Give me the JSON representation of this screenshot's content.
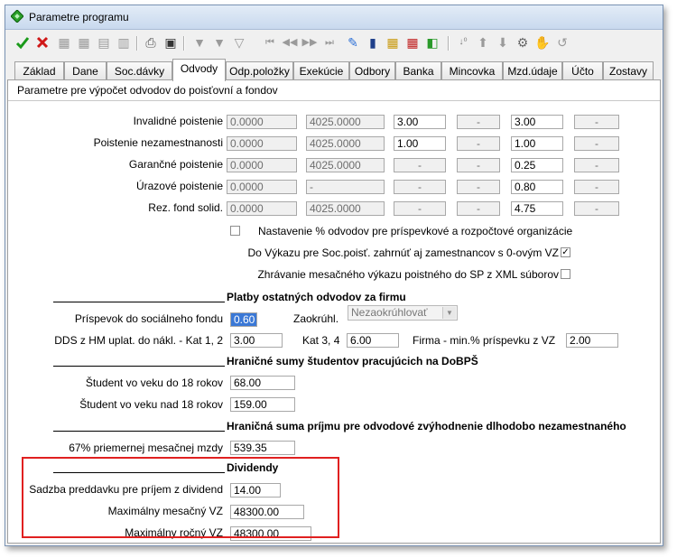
{
  "window": {
    "title": "Parametre programu"
  },
  "tabs": [
    "Základ",
    "Dane",
    "Soc.dávky",
    "Odvody",
    "Odp.položky",
    "Exekúcie",
    "Odbory",
    "Banka",
    "Mincovka",
    "Mzd.údaje",
    "Účto",
    "Zostavy"
  ],
  "active_tab": "Odvody",
  "section_title": "Parametre pre výpočet odvodov do poisťovní a fondov",
  "rows": [
    {
      "label": "Invalidné poistenie",
      "a": "0.0000",
      "b": "4025.0000",
      "c": "3.00",
      "d": "-",
      "e": "3.00",
      "f": "-"
    },
    {
      "label": "Poistenie  nezamestnanosti",
      "a": "0.0000",
      "b": "4025.0000",
      "c": "1.00",
      "d": "-",
      "e": "1.00",
      "f": "-"
    },
    {
      "label": "Garančné poistenie",
      "a": "0.0000",
      "b": "4025.0000",
      "c": "-",
      "d": "-",
      "e": "0.25",
      "f": "-"
    },
    {
      "label": "Úrazové poistenie",
      "a": "0.0000",
      "b": "-",
      "c": "-",
      "d": "-",
      "e": "0.80",
      "f": "-"
    },
    {
      "label": "Rez. fond solid.",
      "a": "0.0000",
      "b": "4025.0000",
      "c": "-",
      "d": "-",
      "e": "4.75",
      "f": "-"
    }
  ],
  "checks": {
    "org": {
      "label": "Nastavenie % odvodov pre príspevkové a rozpočtové organizácie",
      "checked": ""
    },
    "vykaz": {
      "label": "Do Výkazu pre Soc.poisť. zahrnúť aj zamestnancov s 0-ovým VZ",
      "checked": "✓"
    },
    "xml": {
      "label": "Zhrávanie mesačného výkazu poistného do SP z XML súborov",
      "checked": ""
    }
  },
  "platby": {
    "title": "Platby ostatných odvodov za firmu",
    "soc_fond_label": "Príspevok do sociálneho fondu",
    "soc_fond_value": "0.60",
    "zaokr_label": "Zaokrúhl.",
    "zaokr_value": "Nezaokrúhlovať",
    "dds_label": "DDS z HM uplat. do nákl. - Kat 1, 2",
    "dds_value": "3.00",
    "kat34_label": "Kat 3, 4",
    "kat34_value": "6.00",
    "firma_label": "Firma - min.% príspevku z VZ",
    "firma_value": "2.00"
  },
  "studenti": {
    "title": "Hraničné sumy študentov pracujúcich na DoBPŠ",
    "do18_label": "Študent vo veku do 18 rokov",
    "do18_value": "68.00",
    "nad18_label": "Študent vo veku nad 18 rokov",
    "nad18_value": "159.00"
  },
  "dlhodobo": {
    "title": "Hraničná suma príjmu pre odvodové zvýhodnenie dlhodobo nezamestnaného",
    "label": "67% priemernej mesačnej mzdy",
    "value": "539.35"
  },
  "dividendy": {
    "title": "Dividendy",
    "sadzba_label": "Sadzba preddavku pre príjem z dividend",
    "sadzba_value": "14.00",
    "mes_label": "Maximálny mesačný VZ",
    "mes_value": "48300.00",
    "roc_label": "Maximálny ročný VZ",
    "roc_value": "48300.00"
  },
  "colors": {
    "accent": "#2c6fd6",
    "confirm": "#1a9a1a",
    "cancel": "#d01818",
    "highlight": "#e02020"
  }
}
